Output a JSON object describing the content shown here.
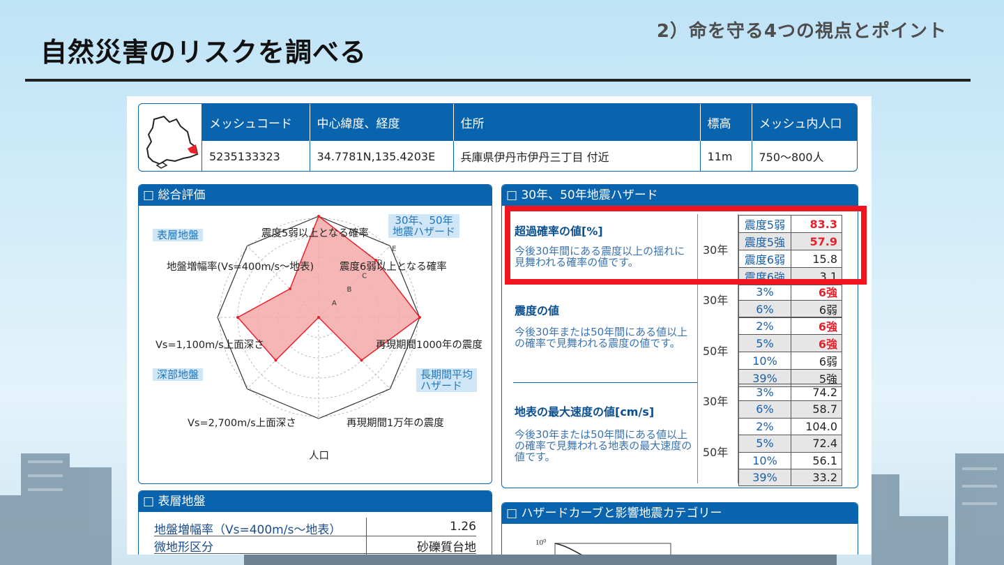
{
  "slide": {
    "title": "自然災害のリスクを調べる",
    "subtitle": "2）命を守る4つの視点とポイント"
  },
  "info": {
    "headers": [
      "メッシュコード",
      "中心緯度、経度",
      "住所",
      "標高",
      "メッシュ内人口"
    ],
    "values": [
      "5235133323",
      "34.7781N,135.4203E",
      "兵庫県伊丹市伊丹三丁目 付近",
      "11m",
      "750～800人"
    ]
  },
  "overall": {
    "title": "□ 総合評価",
    "tags": {
      "surface": "表層地盤",
      "quake_hazard_1": "30年、50年",
      "quake_hazard_2": "地震ハザード",
      "deep": "深部地盤",
      "long_term_1": "長期間平均",
      "long_term_2": "ハザード"
    },
    "axes": [
      "震度5弱以上となる確率",
      "震度6弱以上となる確率",
      "再現期間1000年の震度",
      "再現期間1万年の震度",
      "人口",
      "Vs=2,700m/s上面深さ",
      "Vs=1,100m/s上面深さ",
      "地盤増幅率(Vs=400m/s～地表)"
    ],
    "ring_labels": [
      "A",
      "B",
      "C",
      "D",
      "E"
    ]
  },
  "chart_data": {
    "type": "radar",
    "categories": [
      "震度5弱以上となる確率",
      "震度6弱以上となる確率",
      "再現期間1000年の震度",
      "再現期間1万年の震度",
      "人口",
      "Vs=2,700m/s上面深さ",
      "Vs=1,100m/s上面深さ",
      "地盤増幅率(Vs=400m/s～地表)"
    ],
    "values": [
      5,
      4,
      5,
      3,
      0,
      3,
      4,
      2
    ],
    "ylim": [
      0,
      5
    ],
    "levels": [
      "A",
      "B",
      "C",
      "D",
      "E"
    ],
    "fill_color": "#f4a9a9",
    "line_color": "#e8202b"
  },
  "quake": {
    "title": "□ 30年、50年地震ハザード",
    "exceed": {
      "label": "超過確率の値[%]",
      "desc": "今後30年間にある震度以上の揺れに見舞われる確率の値です。",
      "year": "30年",
      "rows": [
        {
          "k": "震度5弱",
          "v": "83.3",
          "red": true
        },
        {
          "k": "震度5強",
          "v": "57.9",
          "red": true
        },
        {
          "k": "震度6弱",
          "v": "15.8",
          "red": false
        },
        {
          "k": "震度6強",
          "v": "3.1",
          "red": false
        }
      ]
    },
    "intensity": {
      "label": "震度の値",
      "desc": "今後30年または50年間にある値以上の確率で見舞われる震度の値です。",
      "year30": "30年",
      "year50": "50年",
      "rows30": [
        {
          "k": "3%",
          "v": "6強",
          "red": true
        },
        {
          "k": "6%",
          "v": "6弱",
          "red": false
        }
      ],
      "rows50": [
        {
          "k": "2%",
          "v": "6強",
          "red": true
        },
        {
          "k": "5%",
          "v": "6強",
          "red": true
        },
        {
          "k": "10%",
          "v": "6弱",
          "red": false
        },
        {
          "k": "39%",
          "v": "5強",
          "red": false
        }
      ]
    },
    "velocity": {
      "label": "地表の最大速度の値[cm/s]",
      "desc": "今後30年または50年間にある値以上の確率で見舞われる地表の最大速度の値です。",
      "year30": "30年",
      "year50": "50年",
      "rows30": [
        {
          "k": "3%",
          "v": "74.2",
          "red": false
        },
        {
          "k": "6%",
          "v": "58.7",
          "red": false
        }
      ],
      "rows50": [
        {
          "k": "2%",
          "v": "104.0",
          "red": false
        },
        {
          "k": "5%",
          "v": "72.4",
          "red": false
        },
        {
          "k": "10%",
          "v": "56.1",
          "red": false
        },
        {
          "k": "39%",
          "v": "33.2",
          "red": false
        }
      ]
    }
  },
  "surface": {
    "title": "□ 表層地盤",
    "rows": [
      {
        "k": "地盤増幅率（Vs=400m/s～地表）",
        "v": "1.26"
      },
      {
        "k": "微地形区分",
        "v": "砂礫質台地"
      }
    ]
  },
  "hazard_curve": {
    "title": "□ ハザードカーブと影響地震カテゴリー",
    "ytick": "10⁰"
  }
}
